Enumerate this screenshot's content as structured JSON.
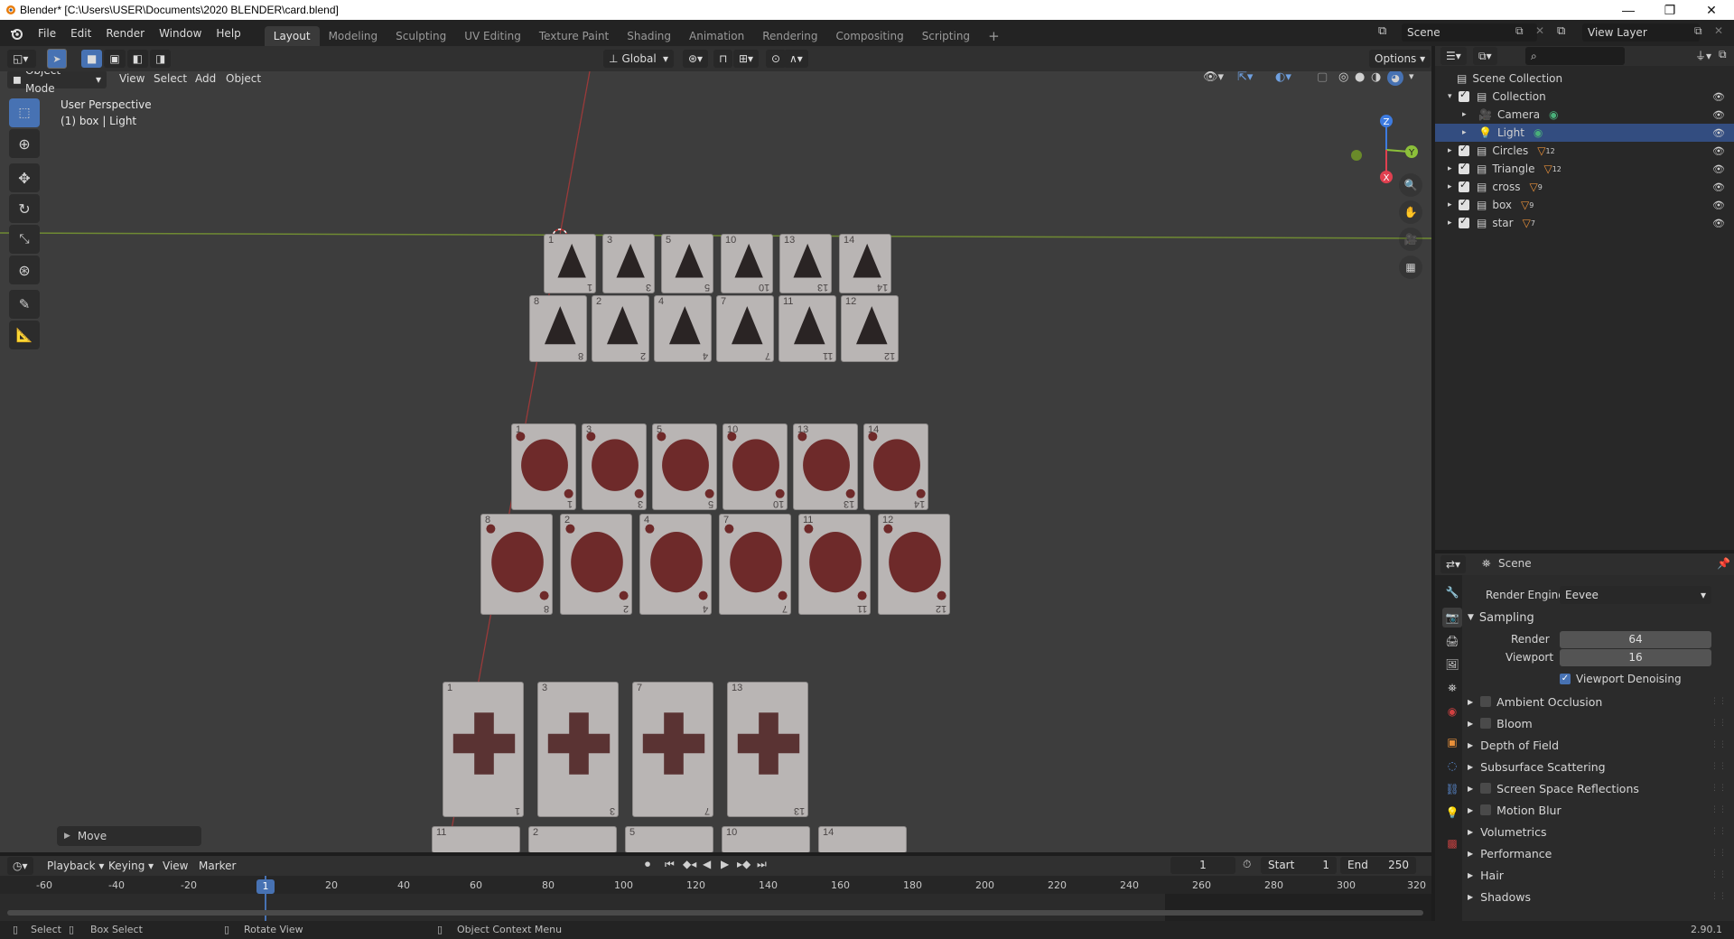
{
  "window": {
    "title": "Blender* [C:\\Users\\USER\\Documents\\2020 BLENDER\\card.blend]"
  },
  "menu": [
    "File",
    "Edit",
    "Render",
    "Window",
    "Help"
  ],
  "workspaces": [
    "Layout",
    "Modeling",
    "Sculpting",
    "UV Editing",
    "Texture Paint",
    "Shading",
    "Animation",
    "Rendering",
    "Compositing",
    "Scripting"
  ],
  "active_workspace": "Layout",
  "scene_name": "Scene",
  "view_layer": "View Layer",
  "viewport": {
    "orientation": "Global",
    "options_label": "Options",
    "mode": "Object Mode",
    "header_menus": [
      "View",
      "Select",
      "Add",
      "Object"
    ],
    "overlay_title": "User Perspective",
    "overlay_subtitle": "(1) box | Light",
    "gizmo": {
      "x": "X",
      "y": "Y",
      "z": "Z"
    },
    "last_op": "Move",
    "cards": {
      "triangles_row1": [
        "1",
        "3",
        "5",
        "10",
        "13",
        "14"
      ],
      "triangles_row1_bottom": [
        "1",
        "3",
        "5",
        "10",
        "13",
        "14"
      ],
      "triangles_row2": [
        "8",
        "2",
        "4",
        "7",
        "11",
        "12"
      ],
      "triangles_row2_bottom": [
        "8",
        "2",
        "4",
        "7",
        "11",
        "12"
      ],
      "circles_row1": [
        "1",
        "3",
        "5",
        "10",
        "13",
        "14"
      ],
      "circles_row2": [
        "8",
        "2",
        "4",
        "7",
        "11",
        "12"
      ],
      "cross_row1": [
        "1",
        "3",
        "7",
        "13"
      ],
      "box_row": [
        "11",
        "2",
        "5",
        "10",
        "14"
      ]
    }
  },
  "outliner": {
    "root": "Scene Collection",
    "items": [
      {
        "label": "Collection",
        "badge": ""
      },
      {
        "label": "Camera",
        "badge": ""
      },
      {
        "label": "Light",
        "badge": ""
      },
      {
        "label": "Circles",
        "badge": "12"
      },
      {
        "label": "Triangle",
        "badge": "12"
      },
      {
        "label": "cross",
        "badge": "9"
      },
      {
        "label": "box",
        "badge": "9"
      },
      {
        "label": "star",
        "badge": "7"
      }
    ]
  },
  "properties": {
    "context": "Scene",
    "render_engine_label": "Render Engine",
    "render_engine": "Eevee",
    "sampling": "Sampling",
    "render_label": "Render",
    "render_value": "64",
    "viewport_label": "Viewport",
    "viewport_value": "16",
    "viewport_denoising": "Viewport Denoising",
    "panels": [
      {
        "label": "Ambient Occlusion",
        "checkbox": true
      },
      {
        "label": "Bloom",
        "checkbox": true
      },
      {
        "label": "Depth of Field",
        "checkbox": false
      },
      {
        "label": "Subsurface Scattering",
        "checkbox": false
      },
      {
        "label": "Screen Space Reflections",
        "checkbox": true
      },
      {
        "label": "Motion Blur",
        "checkbox": true
      },
      {
        "label": "Volumetrics",
        "checkbox": false
      },
      {
        "label": "Performance",
        "checkbox": false
      },
      {
        "label": "Hair",
        "checkbox": false
      },
      {
        "label": "Shadows",
        "checkbox": false
      }
    ]
  },
  "timeline": {
    "menus": [
      "Playback",
      "Keying",
      "View",
      "Marker"
    ],
    "current_frame": "1",
    "start_label": "Start",
    "start": "1",
    "end_label": "End",
    "end": "250",
    "ruler": [
      "-60",
      "-40",
      "-20",
      "1",
      "20",
      "40",
      "60",
      "80",
      "100",
      "120",
      "140",
      "160",
      "180",
      "200",
      "220",
      "240",
      "260",
      "280",
      "300",
      "320"
    ]
  },
  "status": {
    "select": "Select",
    "box_select": "Box Select",
    "rotate": "Rotate View",
    "context_menu": "Object Context Menu",
    "version": "2.90.1"
  },
  "colors": {
    "accent": "#4772b3",
    "card_mark": "#6e2a2a",
    "selection": "#334d80"
  }
}
